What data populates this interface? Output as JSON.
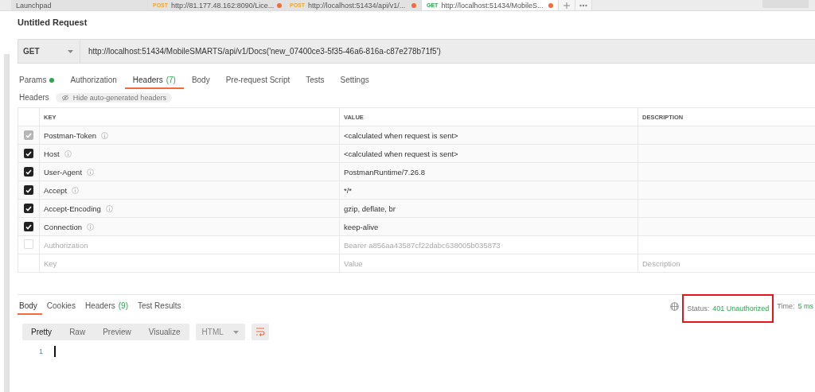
{
  "request_tabs": [
    {
      "label": "Launchpad",
      "selected": false
    },
    {
      "method": "POST",
      "color": "#f5a623",
      "label": "http://81.177.48.162:8090/Lice...",
      "unsaved": true,
      "selected": false
    },
    {
      "method": "POST",
      "color": "#f5a623",
      "label": "http://localhost:51434/api/v1/...",
      "unsaved": true,
      "selected": false
    },
    {
      "method": "GET",
      "color": "#2ea44f",
      "label": "http://localhost:51434/MobileS...",
      "unsaved": true,
      "selected": true
    }
  ],
  "request": {
    "title": "Untitled Request",
    "method": "GET",
    "url": "http://localhost:51434/MobileSMARTS/api/v1/Docs('new_07400ce3-5f35-46a6-816a-c87e278b71f5')"
  },
  "tabs": [
    {
      "label": "Params",
      "indicator": true,
      "selected": false
    },
    {
      "label": "Authorization",
      "selected": false
    },
    {
      "label": "Headers",
      "count": "(7)",
      "selected": true
    },
    {
      "label": "Body",
      "selected": false
    },
    {
      "label": "Pre-request Script",
      "selected": false
    },
    {
      "label": "Tests",
      "selected": false
    },
    {
      "label": "Settings",
      "selected": false
    }
  ],
  "headers_bar": {
    "label": "Headers",
    "toggle": "Hide auto-generated headers"
  },
  "table": {
    "columns": [
      "KEY",
      "VALUE",
      "DESCRIPTION"
    ],
    "rows": [
      {
        "key": "Postman-Token",
        "value": "<calculated when request is sent>",
        "checked": true,
        "disabled": true,
        "info": true
      },
      {
        "key": "Host",
        "value": "<calculated when request is sent>",
        "checked": true,
        "disabled": false,
        "info": true
      },
      {
        "key": "User-Agent",
        "value": "PostmanRuntime/7.26.8",
        "checked": true,
        "disabled": false,
        "info": true
      },
      {
        "key": "Accept",
        "value": "*/*",
        "checked": true,
        "disabled": false,
        "info": true
      },
      {
        "key": "Accept-Encoding",
        "value": "gzip, deflate, br",
        "checked": true,
        "disabled": false,
        "info": true
      },
      {
        "key": "Connection",
        "value": "keep-alive",
        "checked": true,
        "disabled": false,
        "info": true
      },
      {
        "key": "Authorization",
        "value": "Bearer a856aa43587cf22dabc638005b035873",
        "checked": false,
        "disabled": false,
        "info": false
      }
    ],
    "new_row": {
      "key_placeholder": "Key",
      "value_placeholder": "Value",
      "description_placeholder": "Description"
    }
  },
  "response": {
    "tabs": [
      {
        "label": "Body",
        "selected": true
      },
      {
        "label": "Cookies",
        "selected": false
      },
      {
        "label": "Headers",
        "count": "(9)",
        "selected": false
      },
      {
        "label": "Test Results",
        "selected": false
      }
    ],
    "status_label": "Status:",
    "status": "401 Unauthorized",
    "highlighted": true,
    "time_label": "Time:",
    "time": "5 ms",
    "views": [
      {
        "label": "Pretty",
        "selected": true
      },
      {
        "label": "Raw",
        "selected": false
      },
      {
        "label": "Preview",
        "selected": false
      },
      {
        "label": "Visualize",
        "selected": false
      }
    ],
    "format": "HTML",
    "line_numbers": [
      "1"
    ]
  }
}
